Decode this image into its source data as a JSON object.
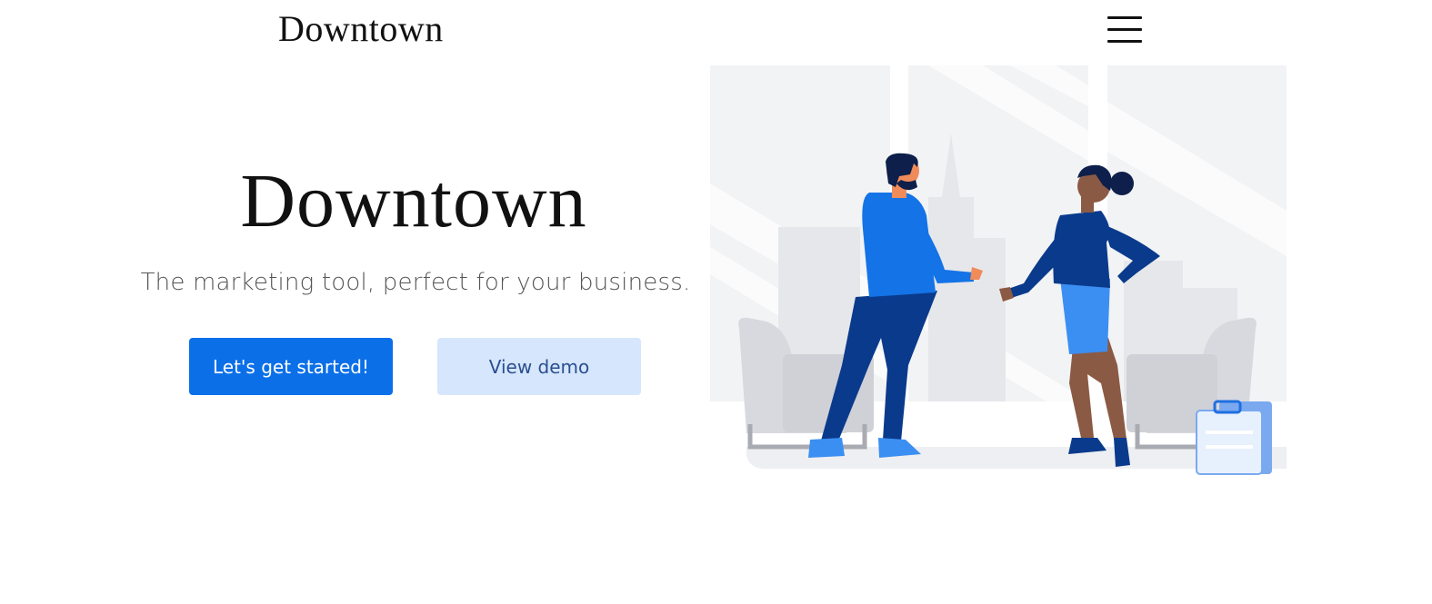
{
  "header": {
    "brand": "Downtown"
  },
  "hero": {
    "title": "Downtown",
    "subtitle": "The marketing tool, perfect for your business.",
    "primary_button": "Let's get started!",
    "secondary_button": "View demo"
  },
  "icons": {
    "menu": "hamburger-menu-icon"
  },
  "colors": {
    "primary": "#0b6fe8",
    "secondary_bg": "#d6e6fc",
    "secondary_text": "#2a4f8f",
    "illustration_blue": "#1473e6",
    "illustration_navy": "#0a3a8c"
  }
}
